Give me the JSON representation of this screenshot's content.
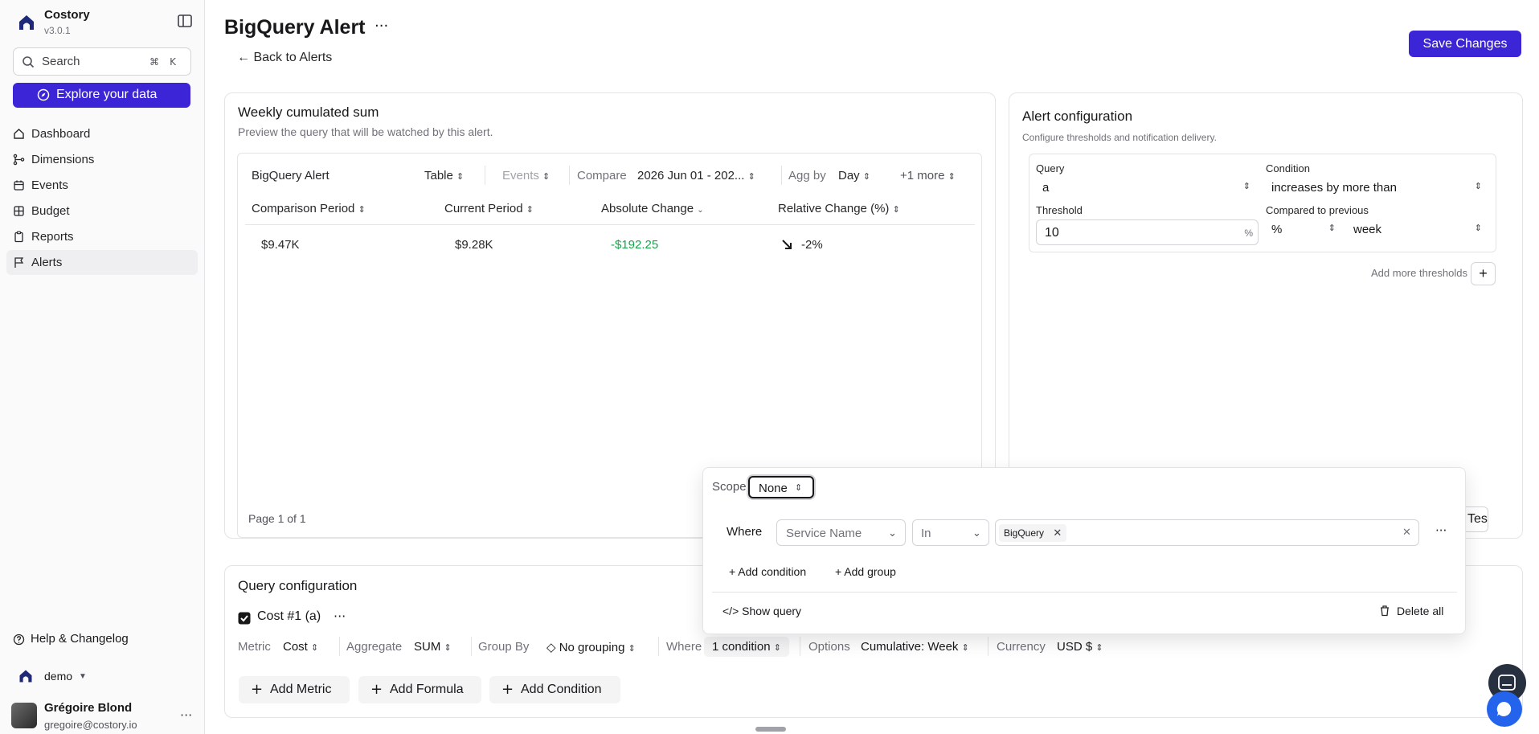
{
  "app": {
    "name": "Costory",
    "version": "v3.0.1"
  },
  "search": {
    "label": "Search",
    "shortcut_cmd": "⌘",
    "shortcut_key": "K"
  },
  "explore_label": "Explore your data",
  "nav": {
    "items": [
      {
        "label": "Dashboard",
        "icon": "dashboard-icon"
      },
      {
        "label": "Dimensions",
        "icon": "dimensions-icon"
      },
      {
        "label": "Events",
        "icon": "calendar-icon"
      },
      {
        "label": "Budget",
        "icon": "budget-icon"
      },
      {
        "label": "Reports",
        "icon": "clipboard-icon"
      },
      {
        "label": "Alerts",
        "icon": "flag-icon"
      }
    ]
  },
  "footer": {
    "help": "Help & Changelog",
    "org": "demo",
    "user_name": "Grégoire Blond",
    "user_email": "gregoire@costory.io"
  },
  "header": {
    "title": "BigQuery Alert",
    "back": "← Back to Alerts",
    "save": "Save Changes"
  },
  "preview": {
    "title": "Weekly cumulated sum",
    "subtitle": "Preview the query that will be watched by this alert.",
    "toolbar": {
      "name": "BigQuery Alert",
      "view": "Table",
      "events": "Events",
      "compare_label": "Compare",
      "compare_value": "2026 Jun 01 - 202...",
      "agg_label": "Agg by",
      "agg_value": "Day",
      "more": "+1 more"
    },
    "columns": [
      "Comparison Period",
      "Current Period",
      "Absolute Change",
      "Relative Change (%)"
    ],
    "row": {
      "comparison": "$9.47K",
      "current": "$9.28K",
      "absolute": "-$192.25",
      "relative": "-2%"
    },
    "pagination": "Page 1 of 1"
  },
  "alert_config": {
    "title": "Alert configuration",
    "subtitle": "Configure thresholds and notification delivery.",
    "query_label": "Query",
    "query_value": "a",
    "condition_label": "Condition",
    "condition_value": "increases by more than",
    "threshold_label": "Threshold",
    "threshold_value": "10",
    "threshold_unit": "%",
    "compared_label": "Compared to previous",
    "compared_unit": "%",
    "compared_period": "week",
    "add_more": "Add more thresholds",
    "test": "Test"
  },
  "query_config": {
    "title": "Query configuration",
    "metric_name": "Cost #1 (a)",
    "metric_label": "Metric",
    "metric_value": "Cost",
    "aggregate_label": "Aggregate",
    "aggregate_value": "SUM",
    "groupby_label": "Group By",
    "groupby_value": "No grouping",
    "where_label": "Where",
    "where_value": "1 condition",
    "options_label": "Options",
    "options_value": "Cumulative: Week",
    "currency_label": "Currency",
    "currency_value": "USD $",
    "add_metric": "Add Metric",
    "add_formula": "Add Formula",
    "add_condition": "Add Condition"
  },
  "filter_popover": {
    "scope_label": "Scope",
    "scope_value": "None",
    "where_label": "Where",
    "field": "Service Name",
    "operator": "In",
    "chip": "BigQuery",
    "add_condition": "+ Add condition",
    "add_group": "+ Add group",
    "show_query": "</> Show query",
    "delete_all": "Delete all"
  },
  "colors": {
    "accent": "#3b25d6",
    "positive": "#16a34a",
    "chat_dark": "#27303f",
    "chat_blue": "#2463eb"
  }
}
